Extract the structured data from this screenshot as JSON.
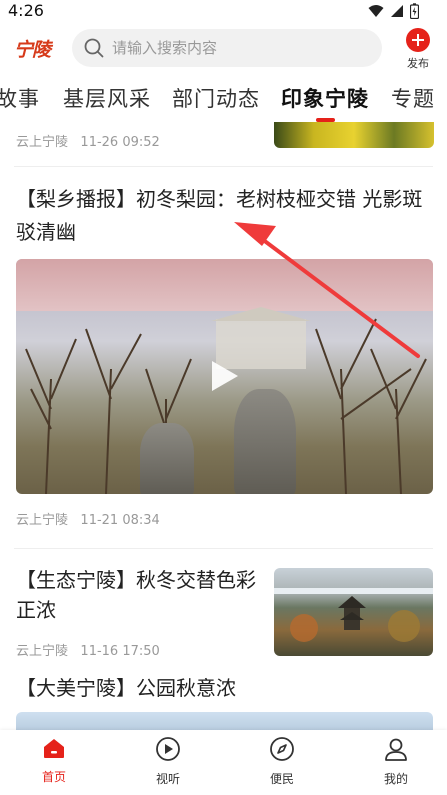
{
  "status_bar": {
    "time": "4:26"
  },
  "header": {
    "logo_text": "宁陵",
    "search_placeholder": "请输入搜索内容",
    "publish_label": "发布"
  },
  "tabs": [
    {
      "label": "故事",
      "active": false
    },
    {
      "label": "基层风采",
      "active": false
    },
    {
      "label": "部门动态",
      "active": false
    },
    {
      "label": "印象宁陵",
      "active": true
    },
    {
      "label": "专题",
      "active": false
    }
  ],
  "feed": [
    {
      "source": "云上宁陵",
      "time": "11-26 09:52"
    },
    {
      "title": "【梨乡播报】初冬梨园：老树枝桠交错 光影斑驳清幽",
      "source": "云上宁陵",
      "time": "11-21 08:34",
      "media": "video"
    },
    {
      "title": "【生态宁陵】秋冬交替色彩正浓",
      "source": "云上宁陵",
      "time": "11-16 17:50"
    },
    {
      "title": "【大美宁陵】公园秋意浓"
    }
  ],
  "bottom_nav": [
    {
      "label": "首页",
      "icon": "home-icon",
      "active": true
    },
    {
      "label": "视听",
      "icon": "play-circle-icon",
      "active": false
    },
    {
      "label": "便民",
      "icon": "compass-icon",
      "active": false
    },
    {
      "label": "我的",
      "icon": "user-icon",
      "active": false
    }
  ],
  "colors": {
    "accent": "#e5221a",
    "arrow": "#ef3b3b"
  }
}
